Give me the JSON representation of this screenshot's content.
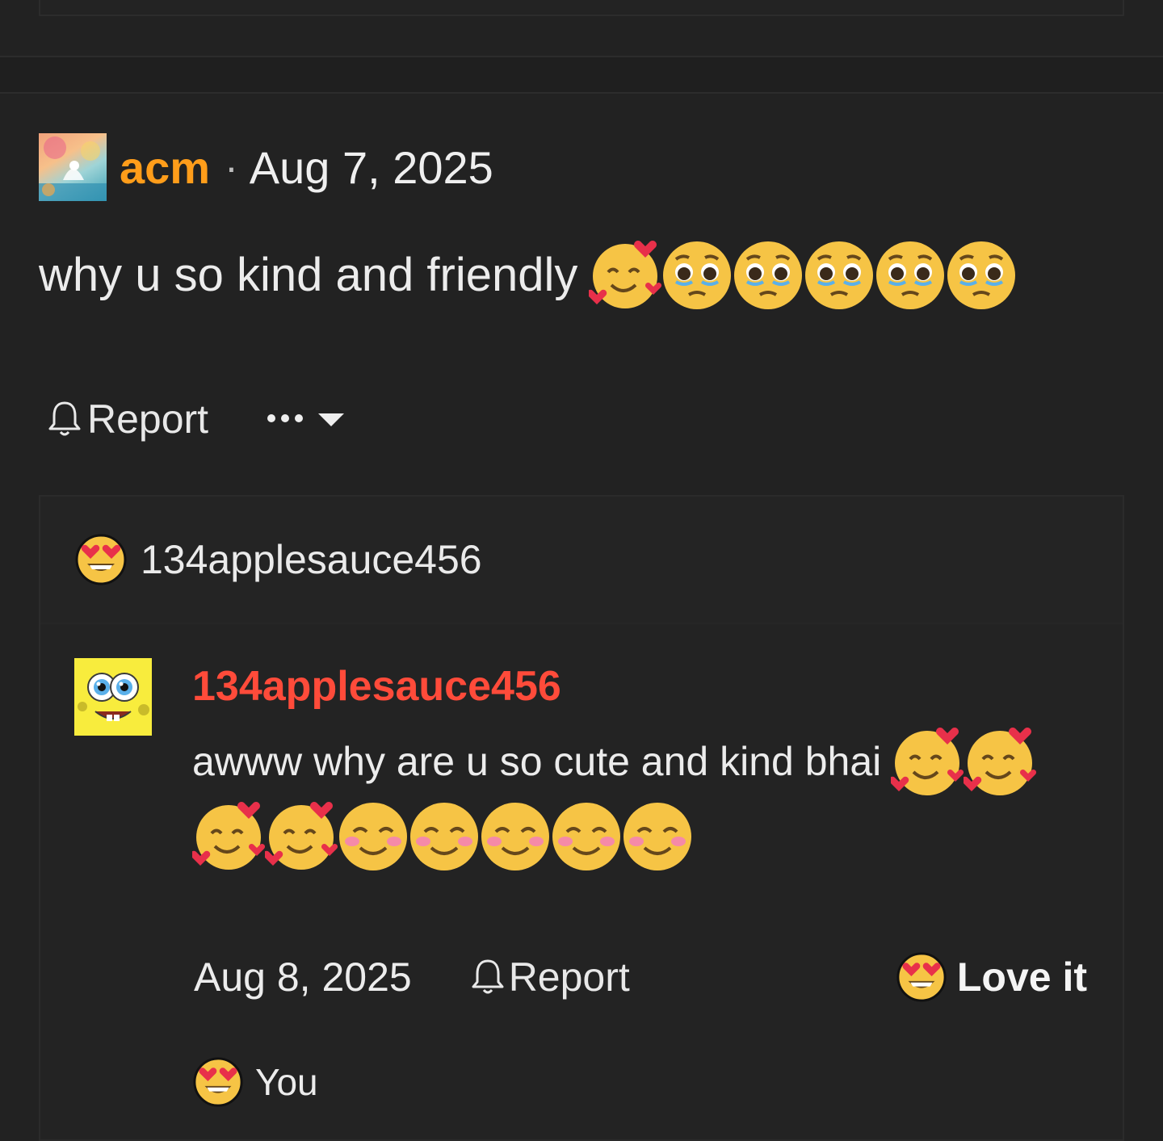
{
  "post": {
    "author": "acm",
    "separator": "·",
    "date": "Aug 7, 2025",
    "text": "why u so kind and friendly",
    "emojis": [
      "smiling-face-with-hearts-icon",
      "pleading-face-icon",
      "pleading-face-icon",
      "pleading-face-icon",
      "pleading-face-icon",
      "pleading-face-icon"
    ],
    "actions": {
      "report_label": "Report"
    }
  },
  "reply_thread": {
    "reaction_user": "134applesauce456",
    "reply": {
      "author": "134applesauce456",
      "text": "awww why are u so cute and kind bhai",
      "emojis_line1": [
        "smiling-face-with-hearts-icon",
        "smiling-face-with-hearts-icon"
      ],
      "emojis_line2": [
        "smiling-face-with-hearts-icon",
        "smiling-face-with-hearts-icon",
        "smiling-face-with-smiling-eyes-icon",
        "smiling-face-with-smiling-eyes-icon",
        "smiling-face-with-smiling-eyes-icon",
        "smiling-face-with-smiling-eyes-icon",
        "smiling-face-with-smiling-eyes-icon"
      ],
      "date": "Aug 8, 2025",
      "report_label": "Report",
      "reaction_label": "Love it"
    },
    "reactors": [
      {
        "name": "You"
      }
    ]
  },
  "colors": {
    "background": "#222222",
    "post_author": "#ff9d1a",
    "reply_author": "#ff4b3a",
    "text": "#ececec"
  }
}
